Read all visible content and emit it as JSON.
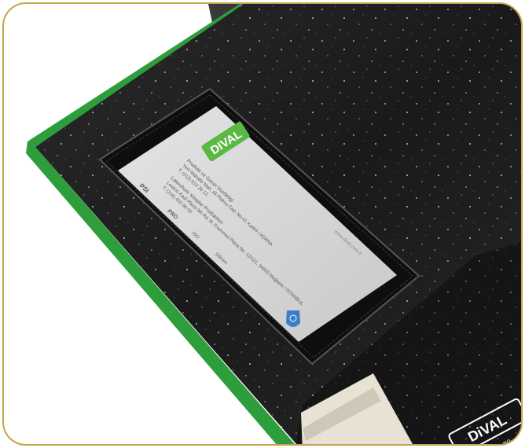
{
  "photo": {
    "subject": "notebook-cover",
    "colors": {
      "frame": "#c8a24a",
      "cover": "#1c1c1c",
      "spine_green": "#2e9e3c",
      "card": "#d9d9d9",
      "logo_green": "#5ab845"
    }
  },
  "card": {
    "logo_text": "DIVAL",
    "line1": "Produkt ve Gecer Hurdeligi",
    "line2": "Yeni Mahalle Mah. Ali Plukcu Cad. No:41 Kadirli / ADANA",
    "line3": "T: (312) 815 26 13",
    "line4": "Lakeshore Kitaplar Produktion",
    "line5": "Lesbos Kadi Plaza 9th Rd. 6l, Frammed Plaza No. 12/121, 34955 Muğkent / İSTANBUL",
    "line6": "T: (216) 455 86 00",
    "website": "www.dival.com.tr",
    "footer_brands": [
      "PSI",
      "PRO",
      "ISO",
      "Dilmen"
    ]
  },
  "cover_logo": {
    "text": "DiVAL",
    "sub": "diary · no"
  }
}
